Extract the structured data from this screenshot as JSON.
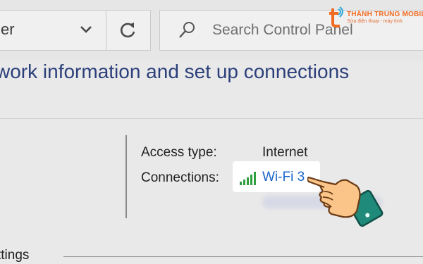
{
  "address": {
    "text": "er"
  },
  "search": {
    "placeholder": "Search Control Panel"
  },
  "logo": {
    "name": "THÀNH TRUNG MOBILE",
    "tagline": "Sửa điện thoại - máy tính"
  },
  "page_title": "work information and set up connections",
  "network": {
    "access_type_label": "Access type:",
    "access_type_value": "Internet",
    "connections_label": "Connections:",
    "connection_link": "Wi-Fi 3"
  },
  "section": {
    "label": "ttings"
  },
  "icons": [
    "chevron-down-icon",
    "refresh-icon",
    "search-icon",
    "wifi-signal-icon",
    "pointing-hand-icon"
  ],
  "colors": {
    "title": "#2b3f7a",
    "link": "#1b66c9",
    "wifi_bars": "#2e9e3e",
    "brand": "#f06b21"
  }
}
